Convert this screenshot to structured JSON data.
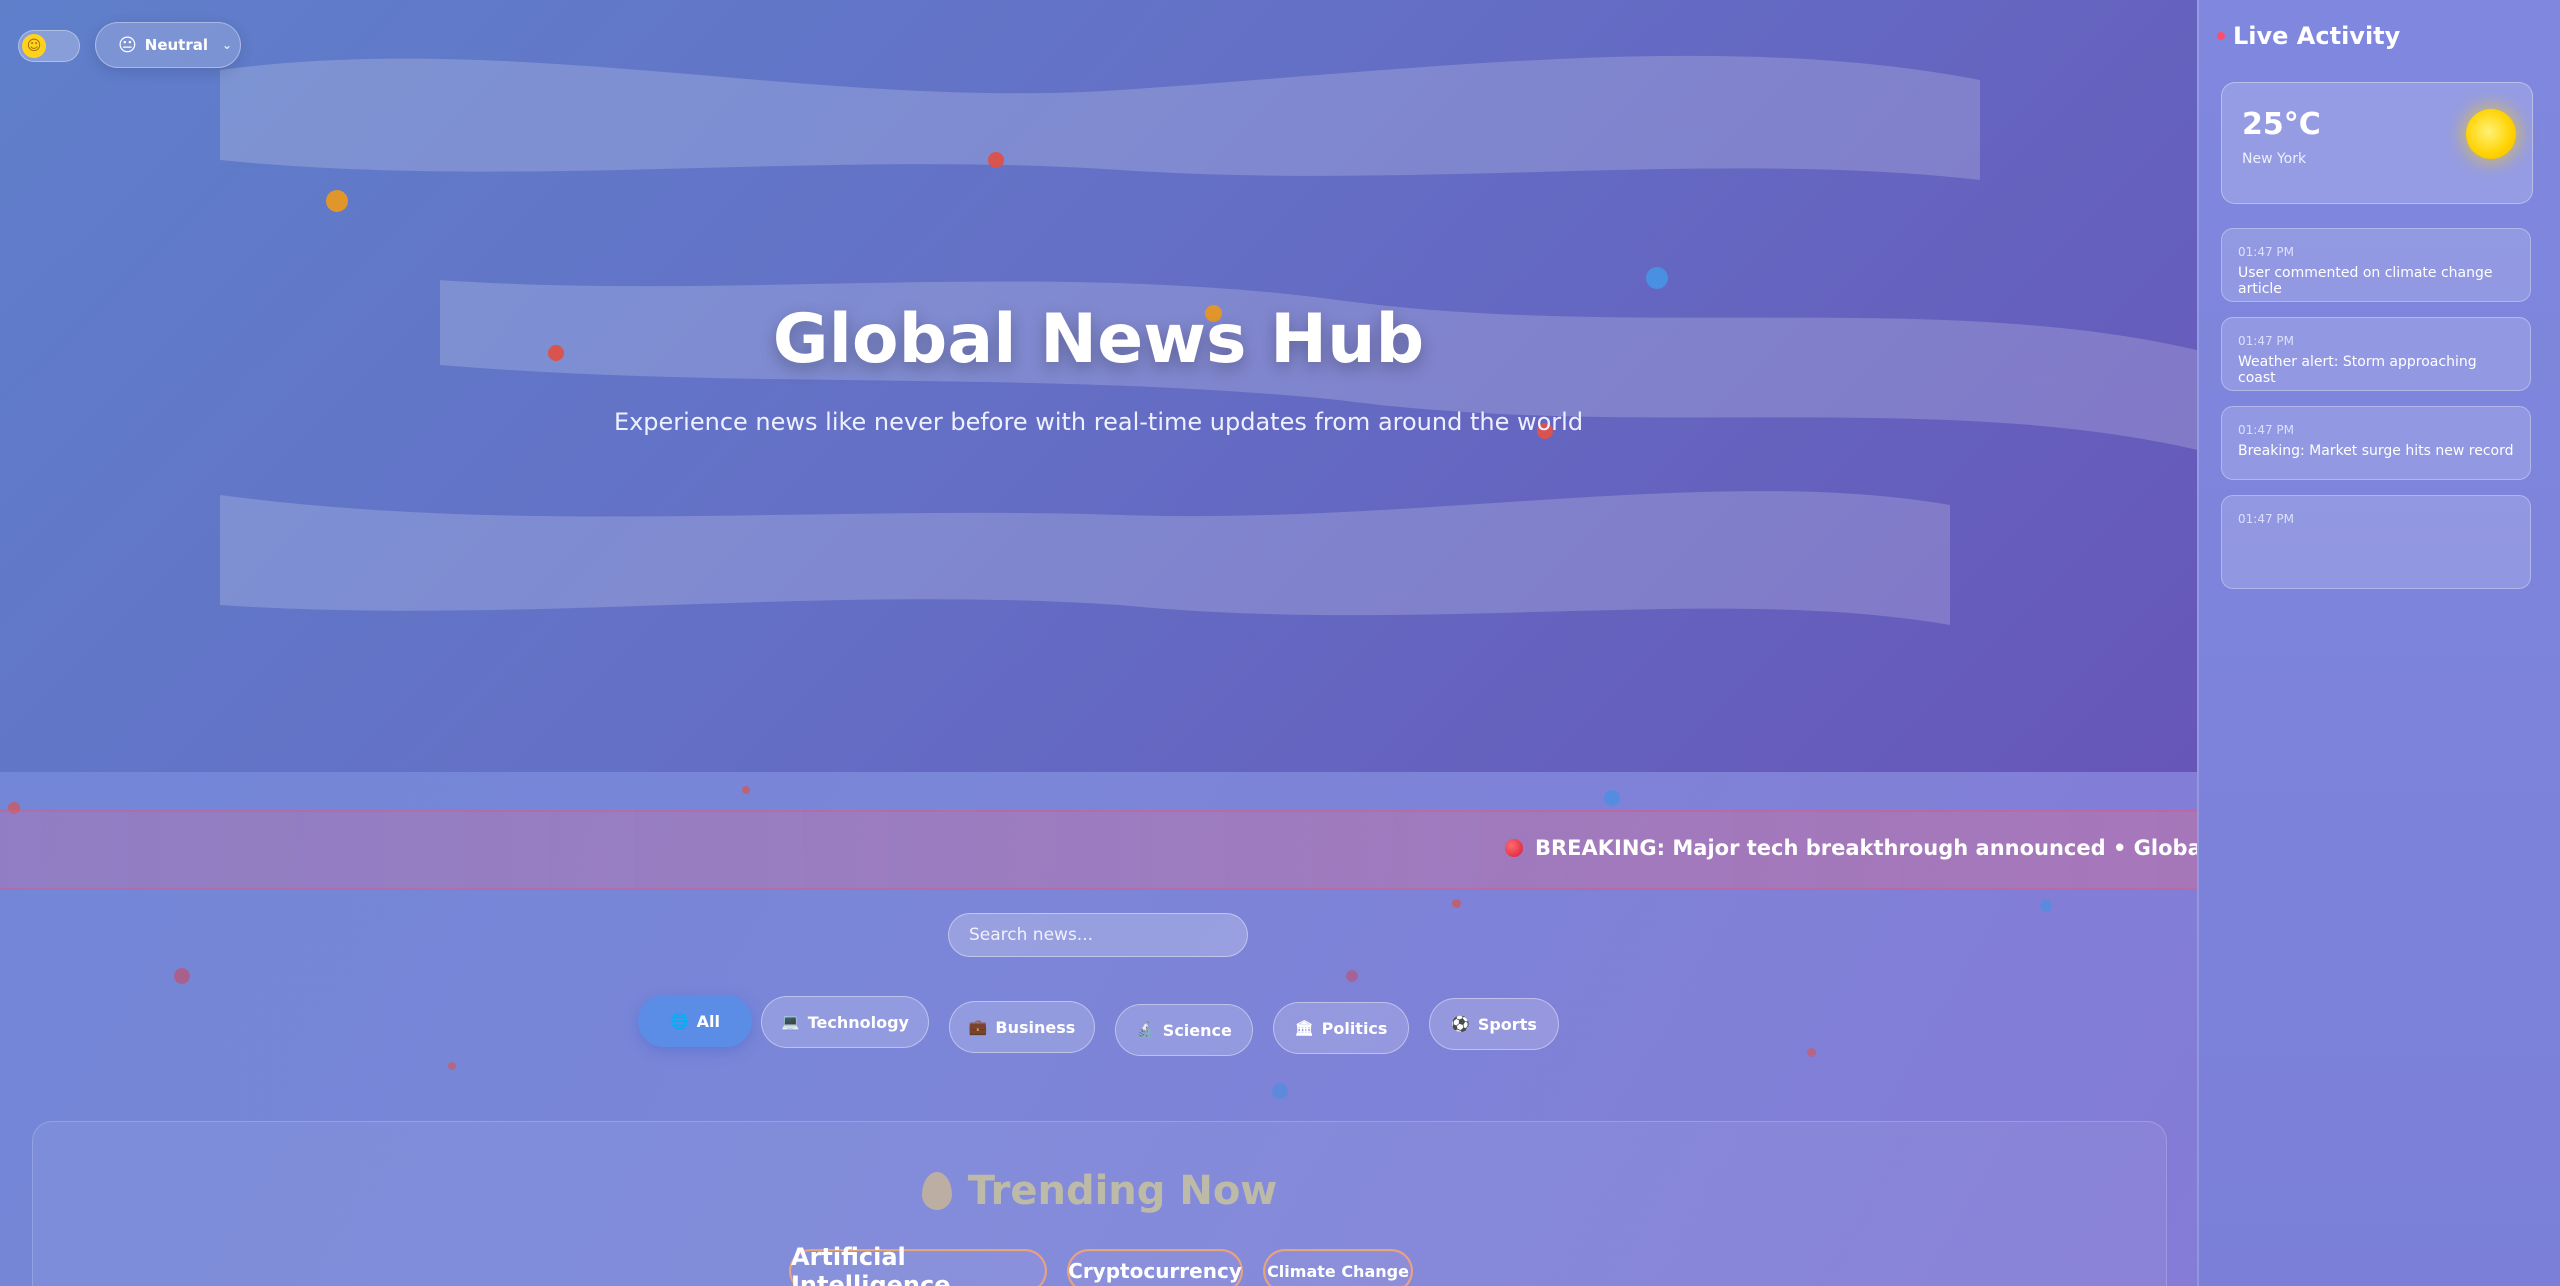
{
  "controls": {
    "theme_toggle_icon": "sun-icon",
    "mood_emoji": "😐",
    "mood_label": "Neutral",
    "mood_caret": "⌄"
  },
  "hero": {
    "title": "Global News Hub",
    "subtitle": "Experience news like never before with real-time updates from around the world"
  },
  "ticker": {
    "text": "BREAKING: Major tech breakthrough announced • Global markets surg"
  },
  "search": {
    "placeholder": "Search news..."
  },
  "categories": [
    {
      "icon": "🌐",
      "label": "All",
      "active": true
    },
    {
      "icon": "💻",
      "label": "Technology"
    },
    {
      "icon": "💼",
      "label": "Business"
    },
    {
      "icon": "🔬",
      "label": "Science"
    },
    {
      "icon": "🏛",
      "label": "Politics"
    },
    {
      "icon": "⚽",
      "label": "Sports"
    }
  ],
  "trending": {
    "title": "Trending Now",
    "tags": [
      "Artificial Intelligence",
      "Cryptocurrency",
      "Climate Change"
    ]
  },
  "sidebar": {
    "title": "Live Activity",
    "weather": {
      "temp": "25°C",
      "city": "New York"
    },
    "activities": [
      {
        "time": "01:47 PM",
        "text": "User commented on climate change article"
      },
      {
        "time": "01:47 PM",
        "text": "Weather alert: Storm approaching coast"
      },
      {
        "time": "01:47 PM",
        "text": "Breaking: Market surge hits new record"
      },
      {
        "time": "01:47 PM",
        "text": ""
      }
    ]
  },
  "colors": {
    "accent": "#5b8de6",
    "live": "#ff4d6d",
    "sun": "#ffd200"
  }
}
